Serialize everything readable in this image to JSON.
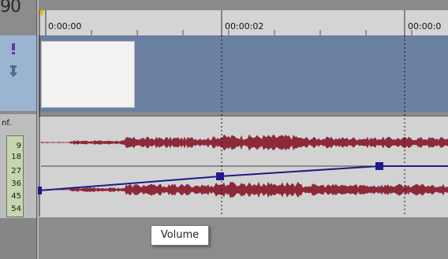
{
  "left_panel": {
    "top_number": "90",
    "audio_label": "nf.",
    "meter_ticks": [
      "9",
      "18",
      "27",
      "36",
      "45",
      "54"
    ]
  },
  "ruler": {
    "time_labels": [
      "0:00:00",
      "00:00:02",
      "00:00:0"
    ]
  },
  "audio": {
    "envelope_name": "Volume",
    "envelope_color": "#1e1a8a",
    "waveform_color": "#8c2a3a"
  },
  "colors": {
    "video_track": "#6b7fa3",
    "audio_track": "#d2d2d2",
    "ruler": "#d4d4d4"
  },
  "icons": [
    "exclamation-icon",
    "arrow-down-icon"
  ]
}
